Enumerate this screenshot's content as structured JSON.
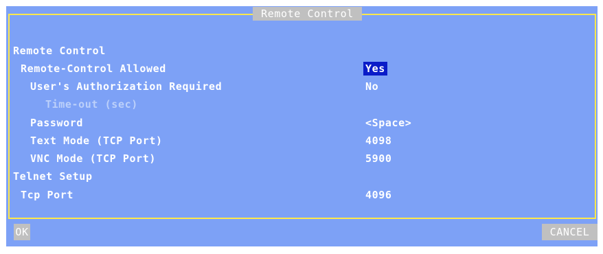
{
  "dialog": {
    "title": "Remote Control"
  },
  "sections": {
    "remote_control": "Remote Control",
    "telnet_setup": "Telnet Setup"
  },
  "fields": {
    "remote_control_allowed": {
      "label": "Remote-Control Allowed",
      "value": "Yes"
    },
    "users_authorization_required": {
      "label": "User's Authorization Required",
      "value": "No"
    },
    "timeout": {
      "label": "Time-out (sec)",
      "value": ""
    },
    "password": {
      "label": "Password",
      "value": "<Space>"
    },
    "text_mode_port": {
      "label": "Text Mode (TCP Port)",
      "value": "4098"
    },
    "vnc_mode_port": {
      "label": "VNC Mode (TCP Port)",
      "value": "5900"
    },
    "tcp_port": {
      "label": "Tcp Port",
      "value": "4096"
    }
  },
  "buttons": {
    "ok": "OK",
    "cancel": "CANCEL"
  },
  "colors": {
    "background": "#7da1f6",
    "frame": "#ffe84a",
    "text": "#ffffff",
    "disabled_text": "#bcd0fa",
    "selection": "#0a1cc8",
    "button": "#c0c0c0"
  }
}
